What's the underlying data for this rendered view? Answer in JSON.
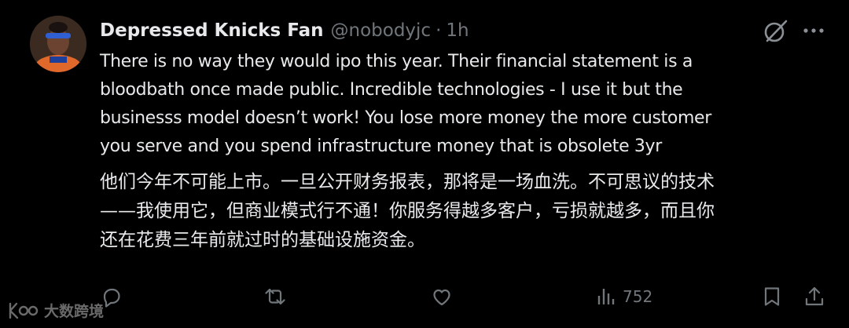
{
  "author": {
    "display_name": "Depressed Knicks Fan",
    "handle": "@nobodyjc",
    "separator": "·",
    "time": "1h"
  },
  "tweet": {
    "text_en": "There is no way they would ipo this year. Their financial statement is a\nbloodbath once made public. Incredible technologies - I use it but the\nbusinesss model doesn’t work! You lose more money the more customer\nyou serve and you spend infrastructure money that is obsolete 3yr",
    "text_zh": "他们今年不可能上市。一旦公开财务报表，那将是一场血洗。不可思议的技术\n——我使用它，但商业模式行不通！你服务得越多客户，亏损就越多，而且你\n还在花费三年前就过时的基础设施资金。"
  },
  "actions": {
    "reply": "reply-icon",
    "retweet": "retweet-icon",
    "like": "heart-icon",
    "views_count": "752",
    "bookmark": "bookmark-icon",
    "share": "share-icon"
  },
  "watermark": {
    "text": "大数跨境"
  },
  "colors": {
    "background": "#000000",
    "primary_text": "#e7e9ea",
    "secondary_text": "#71767b"
  }
}
